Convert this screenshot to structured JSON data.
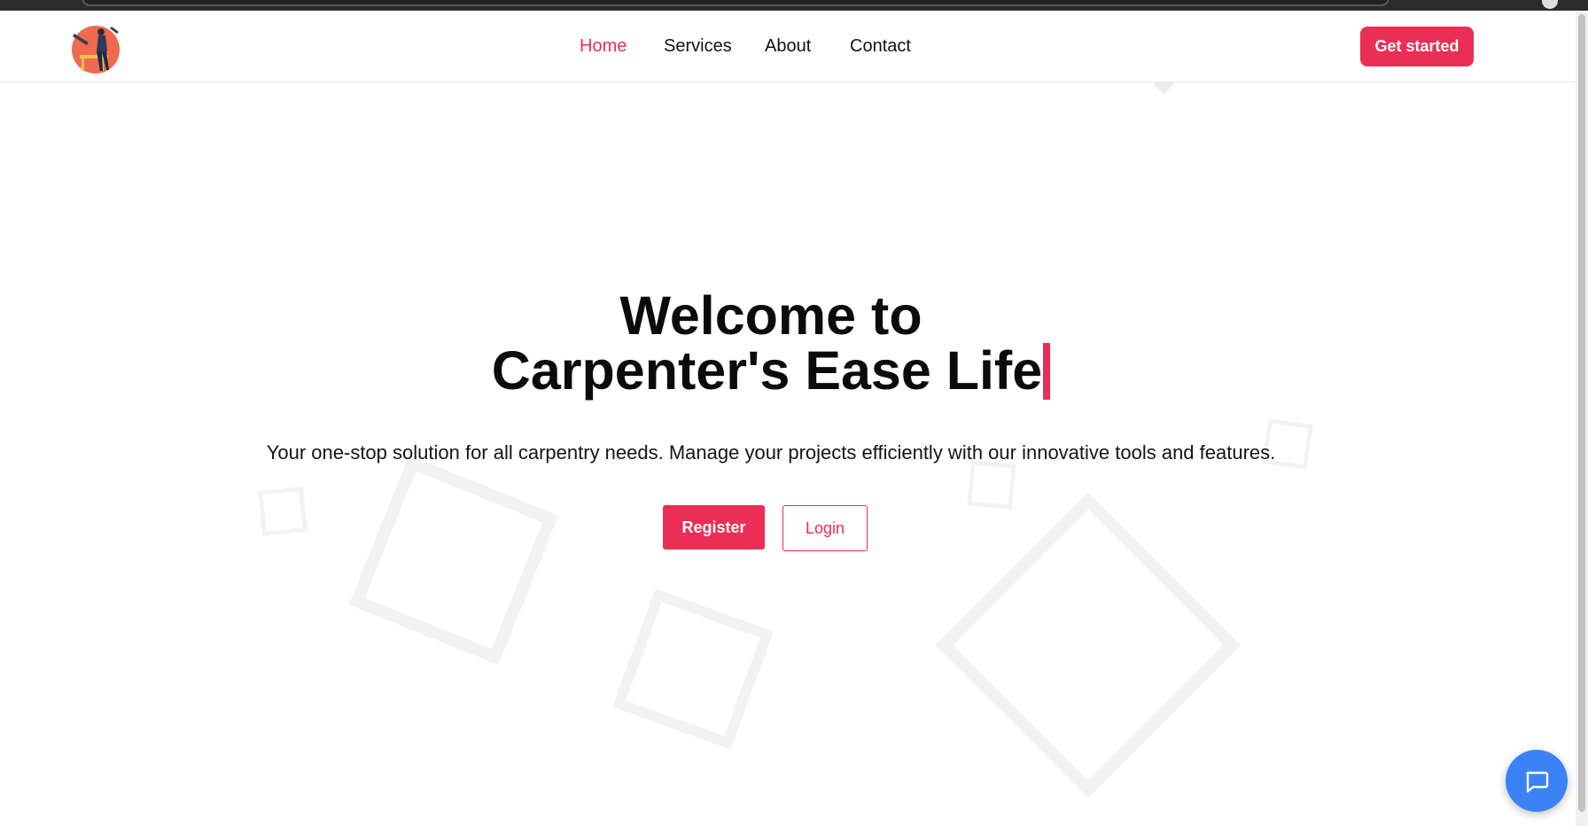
{
  "brand": {
    "logo_icon": "carpenter-illustration-icon",
    "accent_color": "#ea2e55"
  },
  "nav": {
    "items": [
      {
        "label": "Home",
        "active": true
      },
      {
        "label": "Services",
        "active": false
      },
      {
        "label": "About",
        "active": false
      },
      {
        "label": "Contact",
        "active": false
      }
    ],
    "cta_label": "Get started"
  },
  "hero": {
    "title_line1": "Welcome to",
    "title_line2": "Carpenter's Ease Life",
    "subtitle": "Your one-stop solution for all carpentry needs. Manage your projects efficiently with our innovative tools and features.",
    "register_label": "Register",
    "login_label": "Login"
  },
  "chat": {
    "icon": "chat-bubble-icon",
    "color": "#3b82f6"
  }
}
